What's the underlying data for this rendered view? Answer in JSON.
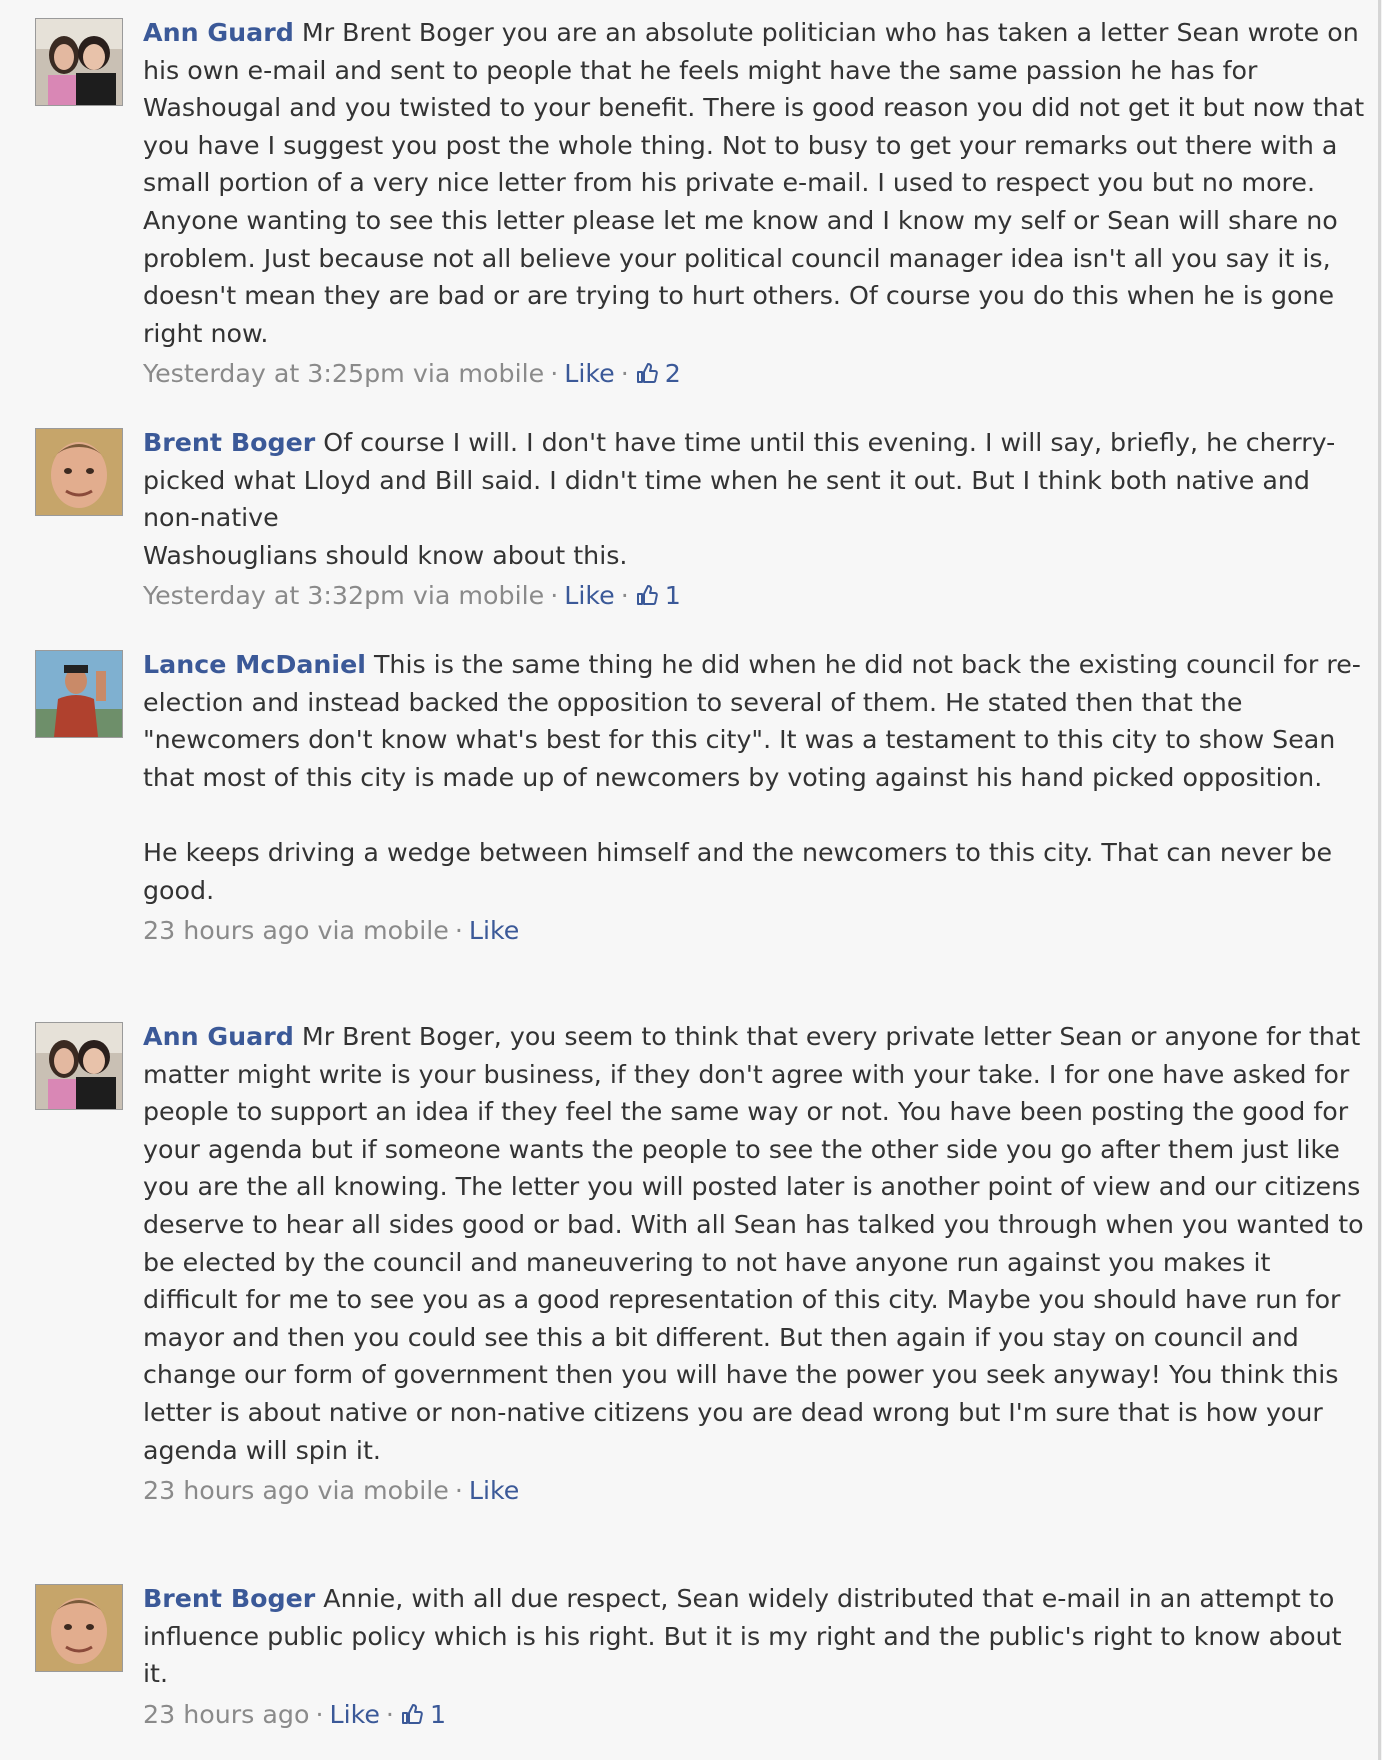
{
  "colors": {
    "author_link": "#3b5998",
    "meta_text": "#8a8a8a",
    "body_text": "#333333",
    "background": "#f7f7f7"
  },
  "comments": [
    {
      "author": "Ann Guard",
      "avatar_icon": "couple-photo-avatar",
      "paragraphs": [
        "Mr Brent Boger you are an absolute politician who has taken a letter Sean wrote on his own e-mail and sent to people that he feels might have the same passion he has for Washougal and you twisted to your benefit. There is good reason you did not get it but now that you have I suggest you post the whole thing. Not to busy to get your remarks out there with a small portion of a very nice letter from his private e-mail. I used to respect you but no more. Anyone wanting to see this letter please let me know and I know my self or Sean will share no problem. Just because not all believe your political council manager idea isn't all you say it is, doesn't mean they are bad or are trying to hurt others. Of course you do this when he is gone right now."
      ],
      "time": "Yesterday at 3:25pm via mobile",
      "like_label": "Like",
      "like_count": "2"
    },
    {
      "author": "Brent Boger",
      "avatar_icon": "man-portrait-avatar",
      "paragraphs": [
        "Of course I will. I don't have time until this evening. I will say, briefly, he cherry-picked what Lloyd and Bill said. I didn't time when he sent it out. But I think both native and non-native"
      ],
      "extra_line": "Washouglians should know about this.",
      "time": "Yesterday at 3:32pm via mobile",
      "like_label": "Like",
      "like_count": "1"
    },
    {
      "author": "Lance McDaniel",
      "avatar_icon": "man-outdoor-photo-avatar",
      "paragraphs": [
        "This is the same thing he did when he did not back the existing council for re-election and instead backed the opposition to several of them. He stated then that the \"newcomers don't know what's best for this city\". It was a testament to this city to show Sean that most of this city is made up of newcomers by voting against his hand picked opposition.",
        "He keeps driving a wedge between himself and the newcomers to this city. That can never be good."
      ],
      "time": "23 hours ago via mobile",
      "like_label": "Like",
      "like_count": ""
    },
    {
      "author": "Ann Guard",
      "avatar_icon": "couple-photo-avatar",
      "paragraphs": [
        "Mr Brent Boger, you seem to think that every private letter Sean or anyone for that matter might write is your business, if they don't agree with your take. I for one have asked for people to support an idea if they feel the same way or not. You have been posting the good for your agenda but if someone wants the people to see the other side you go after them just like you are the all knowing. The letter you will posted later is another point of view and our citizens deserve to hear all sides good or bad. With all Sean has talked you through when you wanted to be elected by the council and maneuvering to not have anyone run against you makes it difficult for me to see you as a good representation of this city. Maybe you should have run for mayor and then you could see this a bit different. But then again if you stay on council and change our form of government then you will have the power you seek anyway! You think this letter is about native or non-native citizens you are dead wrong but I'm sure that is how your agenda will spin it."
      ],
      "time": "23 hours ago via mobile",
      "like_label": "Like",
      "like_count": ""
    },
    {
      "author": "Brent Boger",
      "avatar_icon": "man-portrait-avatar",
      "paragraphs": [
        "Annie, with all due respect, Sean widely distributed that e-mail in an attempt to influence public policy which is his right. But it is my right and the public's right to know about it."
      ],
      "time": "23 hours ago",
      "like_label": "Like",
      "like_count": "1"
    }
  ]
}
